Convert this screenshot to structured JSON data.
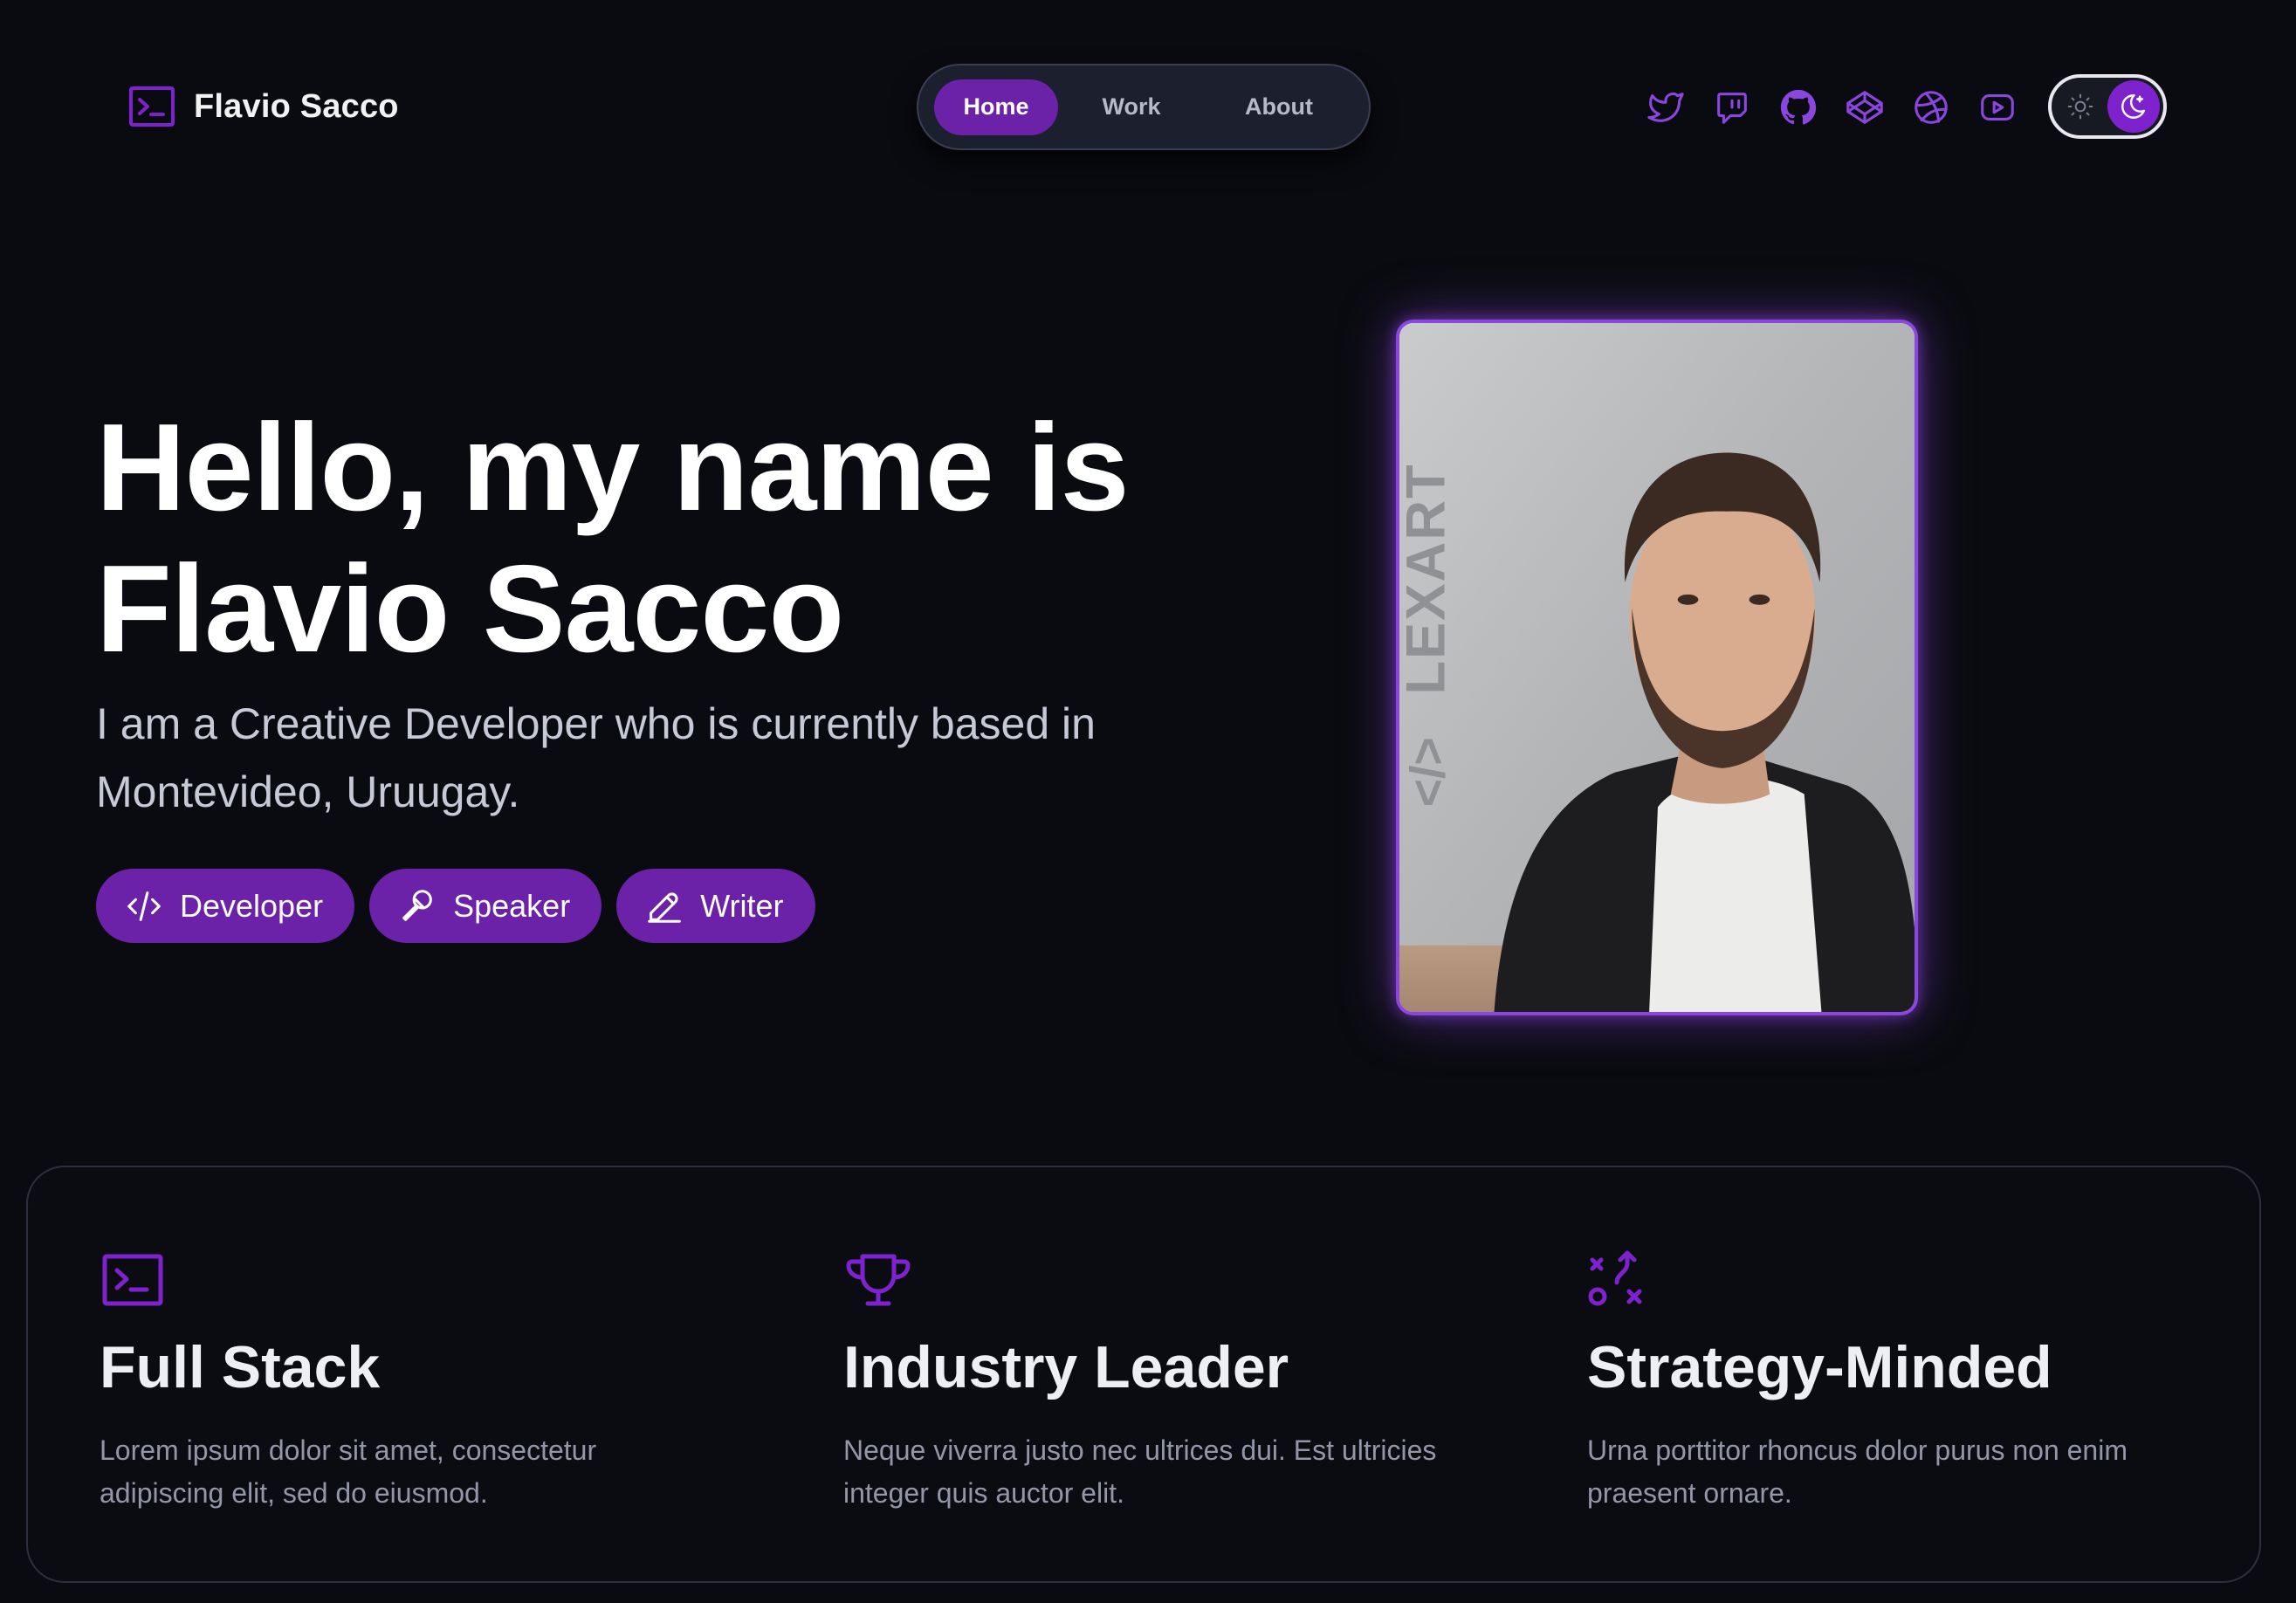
{
  "brand": {
    "name": "Flavio Sacco",
    "icon": "terminal-icon"
  },
  "nav": {
    "items": [
      {
        "label": "Home",
        "active": true
      },
      {
        "label": "Work",
        "active": false
      },
      {
        "label": "About",
        "active": false
      }
    ]
  },
  "socials": [
    {
      "icon": "twitter-icon"
    },
    {
      "icon": "twitch-icon"
    },
    {
      "icon": "github-icon"
    },
    {
      "icon": "codepen-icon"
    },
    {
      "icon": "dribbble-icon"
    },
    {
      "icon": "youtube-icon"
    }
  ],
  "theme_toggle": {
    "mode": "dark",
    "icons": [
      "sun-icon",
      "moon-icon"
    ]
  },
  "hero": {
    "title_line1": "Hello, my name is",
    "title_line2": "Flavio Sacco",
    "subtitle": "I am a Creative Developer who is currently based in Montevideo, Uruugay.",
    "chips": [
      {
        "label": "Developer",
        "icon": "code-icon"
      },
      {
        "label": "Speaker",
        "icon": "microphone-icon"
      },
      {
        "label": "Writer",
        "icon": "pencil-icon"
      }
    ],
    "portrait_wall_text": "LEXART"
  },
  "features": [
    {
      "icon": "terminal-icon",
      "title": "Full Stack",
      "text": "Lorem ipsum dolor sit amet, consectetur adipiscing elit, sed do eiusmod."
    },
    {
      "icon": "trophy-icon",
      "title": "Industry Leader",
      "text": "Neque viverra justo nec ultrices dui. Est ultricies integer quis auctor elit."
    },
    {
      "icon": "strategy-icon",
      "title": "Strategy-Minded",
      "text": "Urna porttitor rhoncus dolor purus non enim praesent ornare."
    }
  ],
  "colors": {
    "background": "#0a0b10",
    "accent": "#6b21a8",
    "accent_light": "#8b46e0",
    "text": "#ffffff",
    "muted_text": "#9496a8"
  }
}
